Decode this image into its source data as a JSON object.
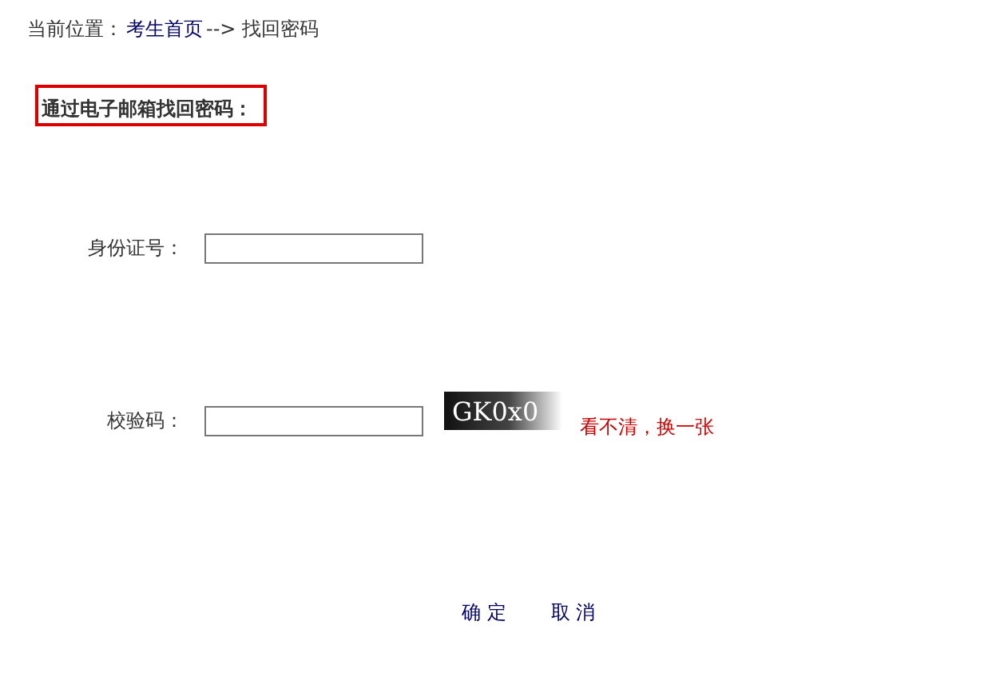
{
  "breadcrumb": {
    "prefix": "当前位置：",
    "link": "考生首页",
    "separator": "-->",
    "current": "找回密码"
  },
  "section_title": "通过电子邮箱找回密码：",
  "fields": [
    {
      "label": "身份证号：",
      "kind": "text"
    },
    {
      "label": "校验码：",
      "kind": "captcha",
      "captcha": "GK0x0",
      "refresh_link": "看不清，换一张"
    }
  ],
  "buttons": [
    "确 定",
    "取 消"
  ]
}
